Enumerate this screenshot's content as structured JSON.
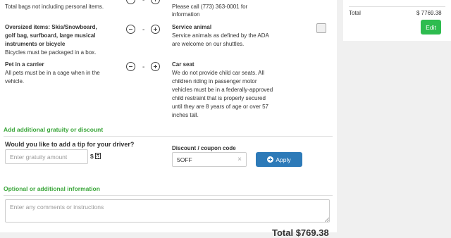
{
  "luggage": {
    "bags_note": "Total bags not including personal items.",
    "oversized_line1": "Oversized items: Skis/Snowboard,",
    "oversized_line2": "golf bag, surfboard, large musical",
    "oversized_line3": "instruments or bicycle",
    "oversized_note": "Bicycles must be packaged in a box.",
    "pet_title": "Pet in a carrier",
    "pet_line1": "All pets must be in a cage when in the",
    "pet_line2": "vehicle.",
    "stepper_value": "-"
  },
  "services": {
    "call_line1": "Please call (773) 363-0001 for",
    "call_line2": "information",
    "service_animal_title": "Service animal",
    "service_animal_line1": "Service animals as defined by the ADA",
    "service_animal_line2": "are welcome on our shuttles.",
    "car_seat_title": "Car seat",
    "car_seat_lines": [
      "We do not provide child car seats. All",
      "children riding in passenger motor",
      "vehicles must be in a federally-approved",
      "child restraint that is properly secured",
      "until they are 8 years of age or over 57",
      "inches tall."
    ]
  },
  "gratuity": {
    "section_title": "Add additional gratuity or discount",
    "tip_question": "Would you like to add a tip for your driver?",
    "tip_placeholder": "Enter gratuity amount",
    "currency": "$",
    "discount_label": "Discount / coupon code",
    "discount_value": "5OFF",
    "clear_symbol": "×",
    "apply_label": "Apply"
  },
  "optional": {
    "section_title": "Optional or additional information",
    "comments_placeholder": "Enter any comments or instructions"
  },
  "footer": {
    "total_partial": "Total $769.38"
  },
  "sidebar": {
    "total_label": "Total",
    "total_value": "$ 7769.38",
    "edit_label": "Edit"
  },
  "colors": {
    "accent_green": "#3aa63a",
    "apply_blue": "#2d7ab8",
    "edit_green": "#2ebc4f"
  },
  "icons": [
    "minus-circle-icon",
    "plus-circle-icon",
    "calculator-icon",
    "plus-circle-filled-icon",
    "clear-icon",
    "resize-grip-icon"
  ]
}
